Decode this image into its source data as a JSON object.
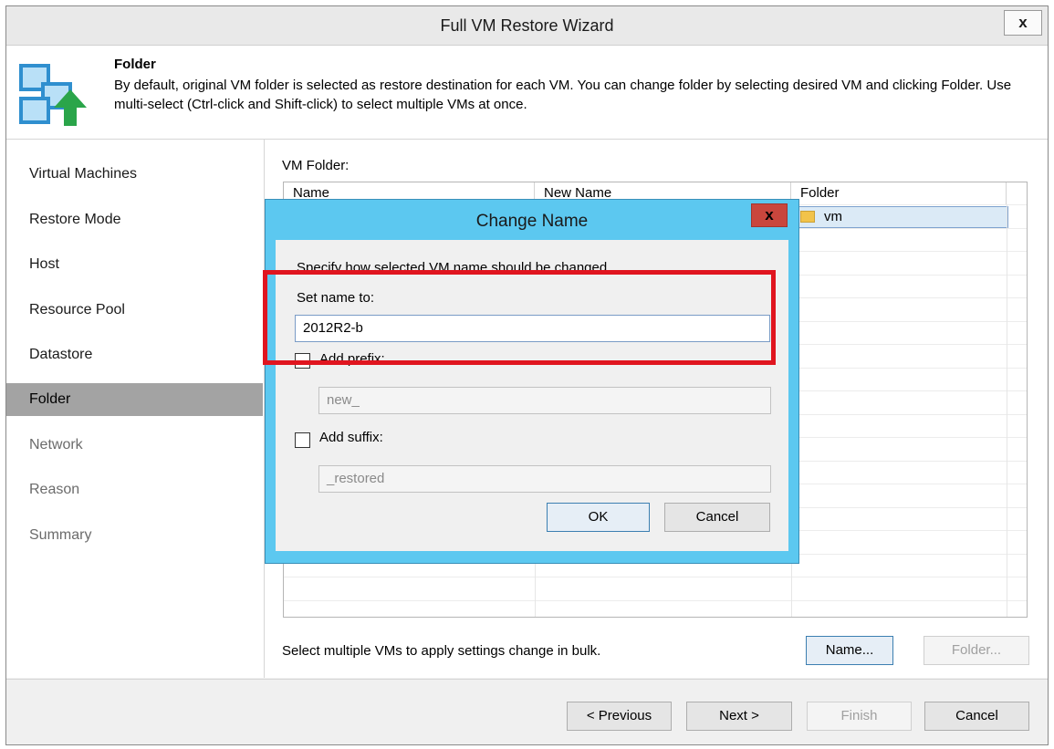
{
  "window": {
    "title": "Full VM Restore Wizard",
    "close_label": "x"
  },
  "header": {
    "title": "Folder",
    "description": "By default, original VM folder is selected as restore destination for each VM. You can change folder by selecting desired VM and clicking Folder. Use multi-select (Ctrl-click and Shift-click) to select multiple VMs at once.",
    "icon": "restore-vm-icon"
  },
  "sidebar": {
    "items": [
      {
        "label": "Virtual Machines"
      },
      {
        "label": "Restore Mode"
      },
      {
        "label": "Host"
      },
      {
        "label": "Resource Pool"
      },
      {
        "label": "Datastore"
      },
      {
        "label": "Folder"
      },
      {
        "label": "Network"
      },
      {
        "label": "Reason"
      },
      {
        "label": "Summary"
      }
    ],
    "active": "Folder"
  },
  "main": {
    "vm_folder_label": "VM Folder:",
    "columns": [
      "Name",
      "New Name",
      "Folder"
    ],
    "rows": [
      {
        "name": "",
        "new_name": "",
        "folder": "vm"
      }
    ],
    "bulk_hint": "Select multiple VMs to apply settings change in bulk.",
    "name_button": "Name...",
    "folder_button": "Folder..."
  },
  "footer": {
    "previous": "< Previous",
    "next": "Next >",
    "finish": "Finish",
    "cancel": "Cancel"
  },
  "dialog": {
    "title": "Change Name",
    "close_label": "x",
    "instruction": "Specify how selected VM name should be changed",
    "set_name_label": "Set name to:",
    "set_name_value": "2012R2-b",
    "add_prefix_label": "Add prefix:",
    "prefix_value": "new_",
    "add_suffix_label": "Add suffix:",
    "suffix_value": "_restored",
    "ok": "OK",
    "cancel": "Cancel"
  },
  "colors": {
    "dialog_frame": "#5cc8f0",
    "highlight": "#e0151f",
    "active_sidebar": "#a3a3a3"
  }
}
